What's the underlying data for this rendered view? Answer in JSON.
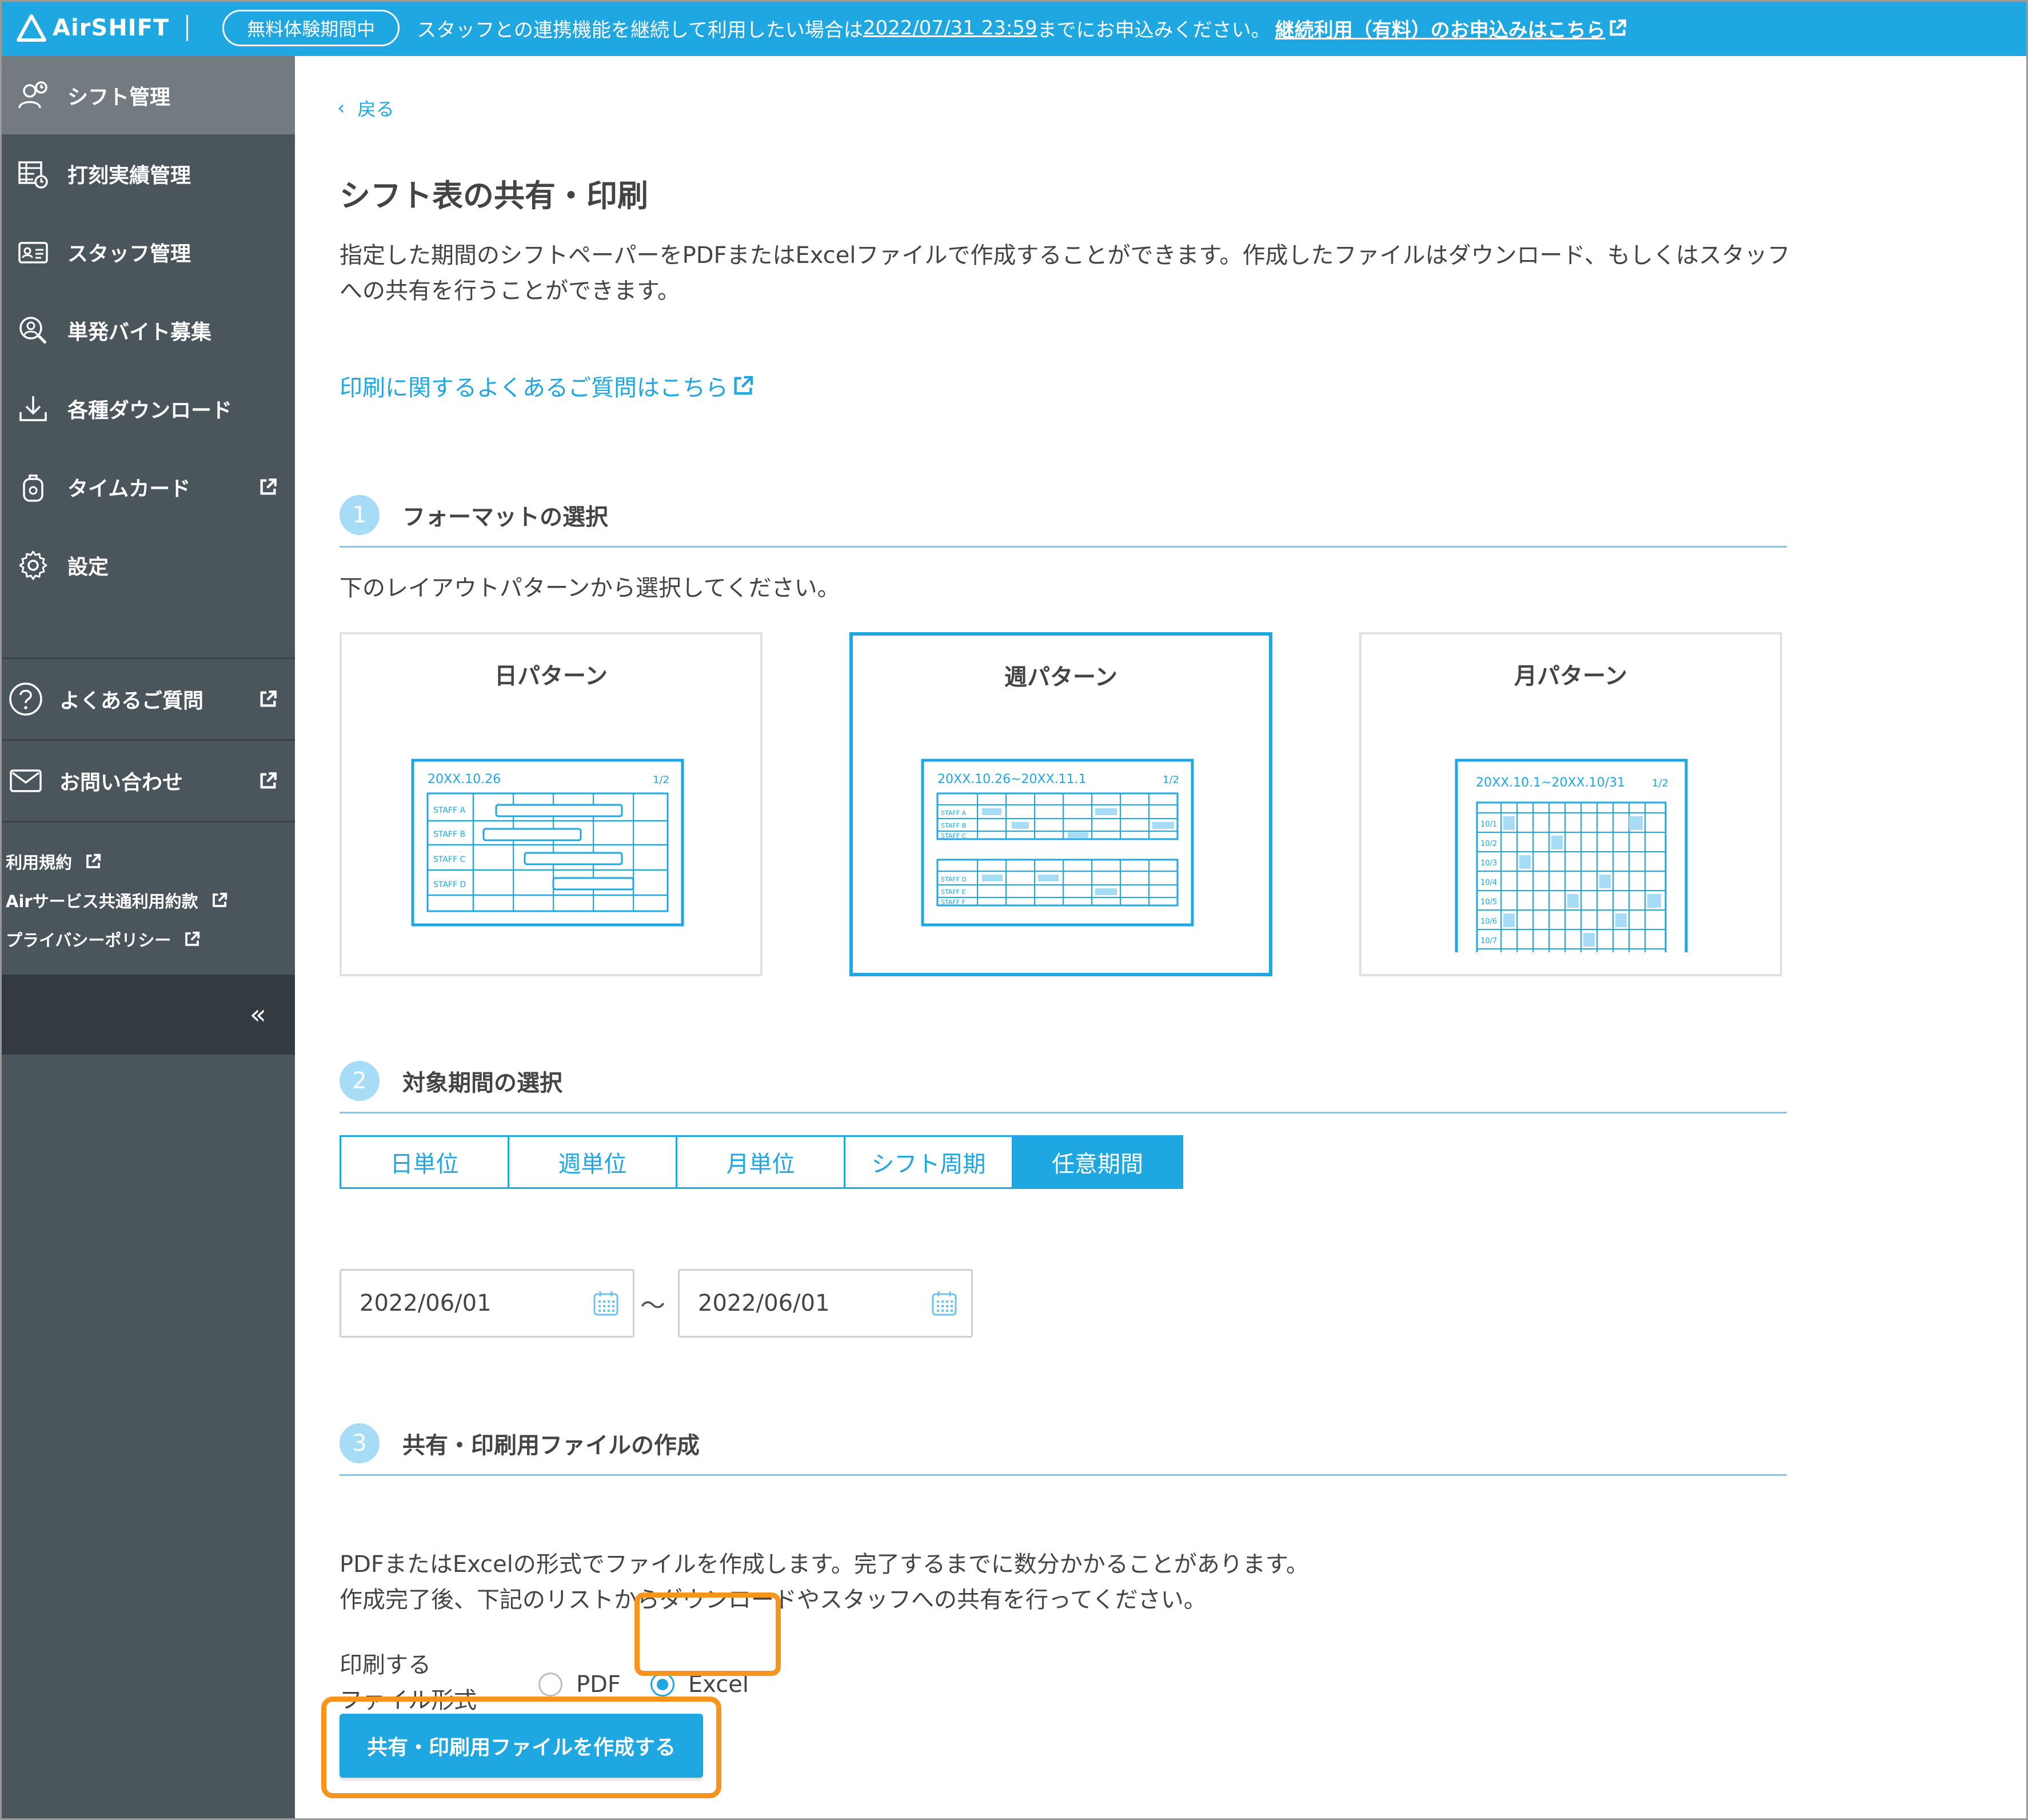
{
  "colors": {
    "accent": "#1ea7e1",
    "sidebar": "#4b555c",
    "highlight": "#f7941d"
  },
  "banner": {
    "logo": "AirSHIFT",
    "trial_badge": "無料体験期間中",
    "message_before": "スタッフとの連携機能を継続して利用したい場合は",
    "deadline": "2022/07/31 23:59",
    "message_after": "までにお申込みください。",
    "apply_link": "継続利用（有料）のお申込みはこちら",
    "icon": "external-link-icon"
  },
  "sidebar": {
    "items": [
      {
        "label": "シフト管理",
        "icon": "shift-icon"
      },
      {
        "label": "打刻実績管理",
        "icon": "clock-table-icon"
      },
      {
        "label": "スタッフ管理",
        "icon": "staff-card-icon"
      },
      {
        "label": "単発バイト募集",
        "icon": "recruit-search-icon"
      },
      {
        "label": "各種ダウンロード",
        "icon": "download-icon"
      },
      {
        "label": "タイムカード",
        "icon": "timecard-icon"
      },
      {
        "label": "設定",
        "icon": "gear-icon"
      }
    ],
    "support": [
      {
        "label": "よくあるご質問",
        "icon": "help-icon"
      },
      {
        "label": "お問い合わせ",
        "icon": "mail-icon"
      }
    ],
    "legal": [
      "利用規約",
      "Airサービス共通利用約款",
      "プライバシーポリシー"
    ],
    "collapse": "«"
  },
  "main": {
    "back": "戻る",
    "title": "シフト表の共有・印刷",
    "intro": "指定した期間のシフトペーパーをPDFまたはExcelファイルで作成することができます。作成したファイルはダウンロード、もしくはスタッフへの共有を行うことができます。",
    "faq_link": "印刷に関するよくあるご質問はこちら",
    "step1": {
      "num": "1",
      "title": "フォーマットの選択",
      "desc": "下のレイアウトパターンから選択してください。",
      "patterns": [
        {
          "label": "日パターン",
          "preview_date": "20XX.10.26",
          "page": "1/2",
          "staff": [
            "STAFF A",
            "STAFF B",
            "STAFF C",
            "STAFF D"
          ]
        },
        {
          "label": "週パターン",
          "preview_date": "20XX.10.26~20XX.11.1",
          "page": "1/2",
          "staff": [
            "STAFF A",
            "STAFF B",
            "STAFF C",
            "STAFF D",
            "STAFF E",
            "STAFF F"
          ]
        },
        {
          "label": "月パターン",
          "preview_date": "20XX.10.1~20XX.10/31",
          "page": "1/2",
          "days": [
            "10/1",
            "10/2",
            "10/3",
            "10/4",
            "10/5",
            "10/6",
            "10/7"
          ]
        }
      ],
      "selected": "週パターン"
    },
    "step2": {
      "num": "2",
      "title": "対象期間の選択",
      "tabs": [
        "日単位",
        "週単位",
        "月単位",
        "シフト周期",
        "任意期間"
      ],
      "active_tab": "任意期間",
      "date_from": "2022/06/01",
      "separator": "〜",
      "date_to": "2022/06/01"
    },
    "step3": {
      "num": "3",
      "title": "共有・印刷用ファイルの作成",
      "desc_line1": "PDFまたはExcelの形式でファイルを作成します。完了するまでに数分かかることがあります。",
      "desc_line2": "作成完了後、下記のリストからダウンロードやスタッフへの共有を行ってください。",
      "format_label_line1": "印刷する",
      "format_label_line2": "ファイル形式",
      "options": [
        "PDF",
        "Excel"
      ],
      "selected_option": "Excel",
      "create_button": "共有・印刷用ファイルを作成する"
    }
  }
}
